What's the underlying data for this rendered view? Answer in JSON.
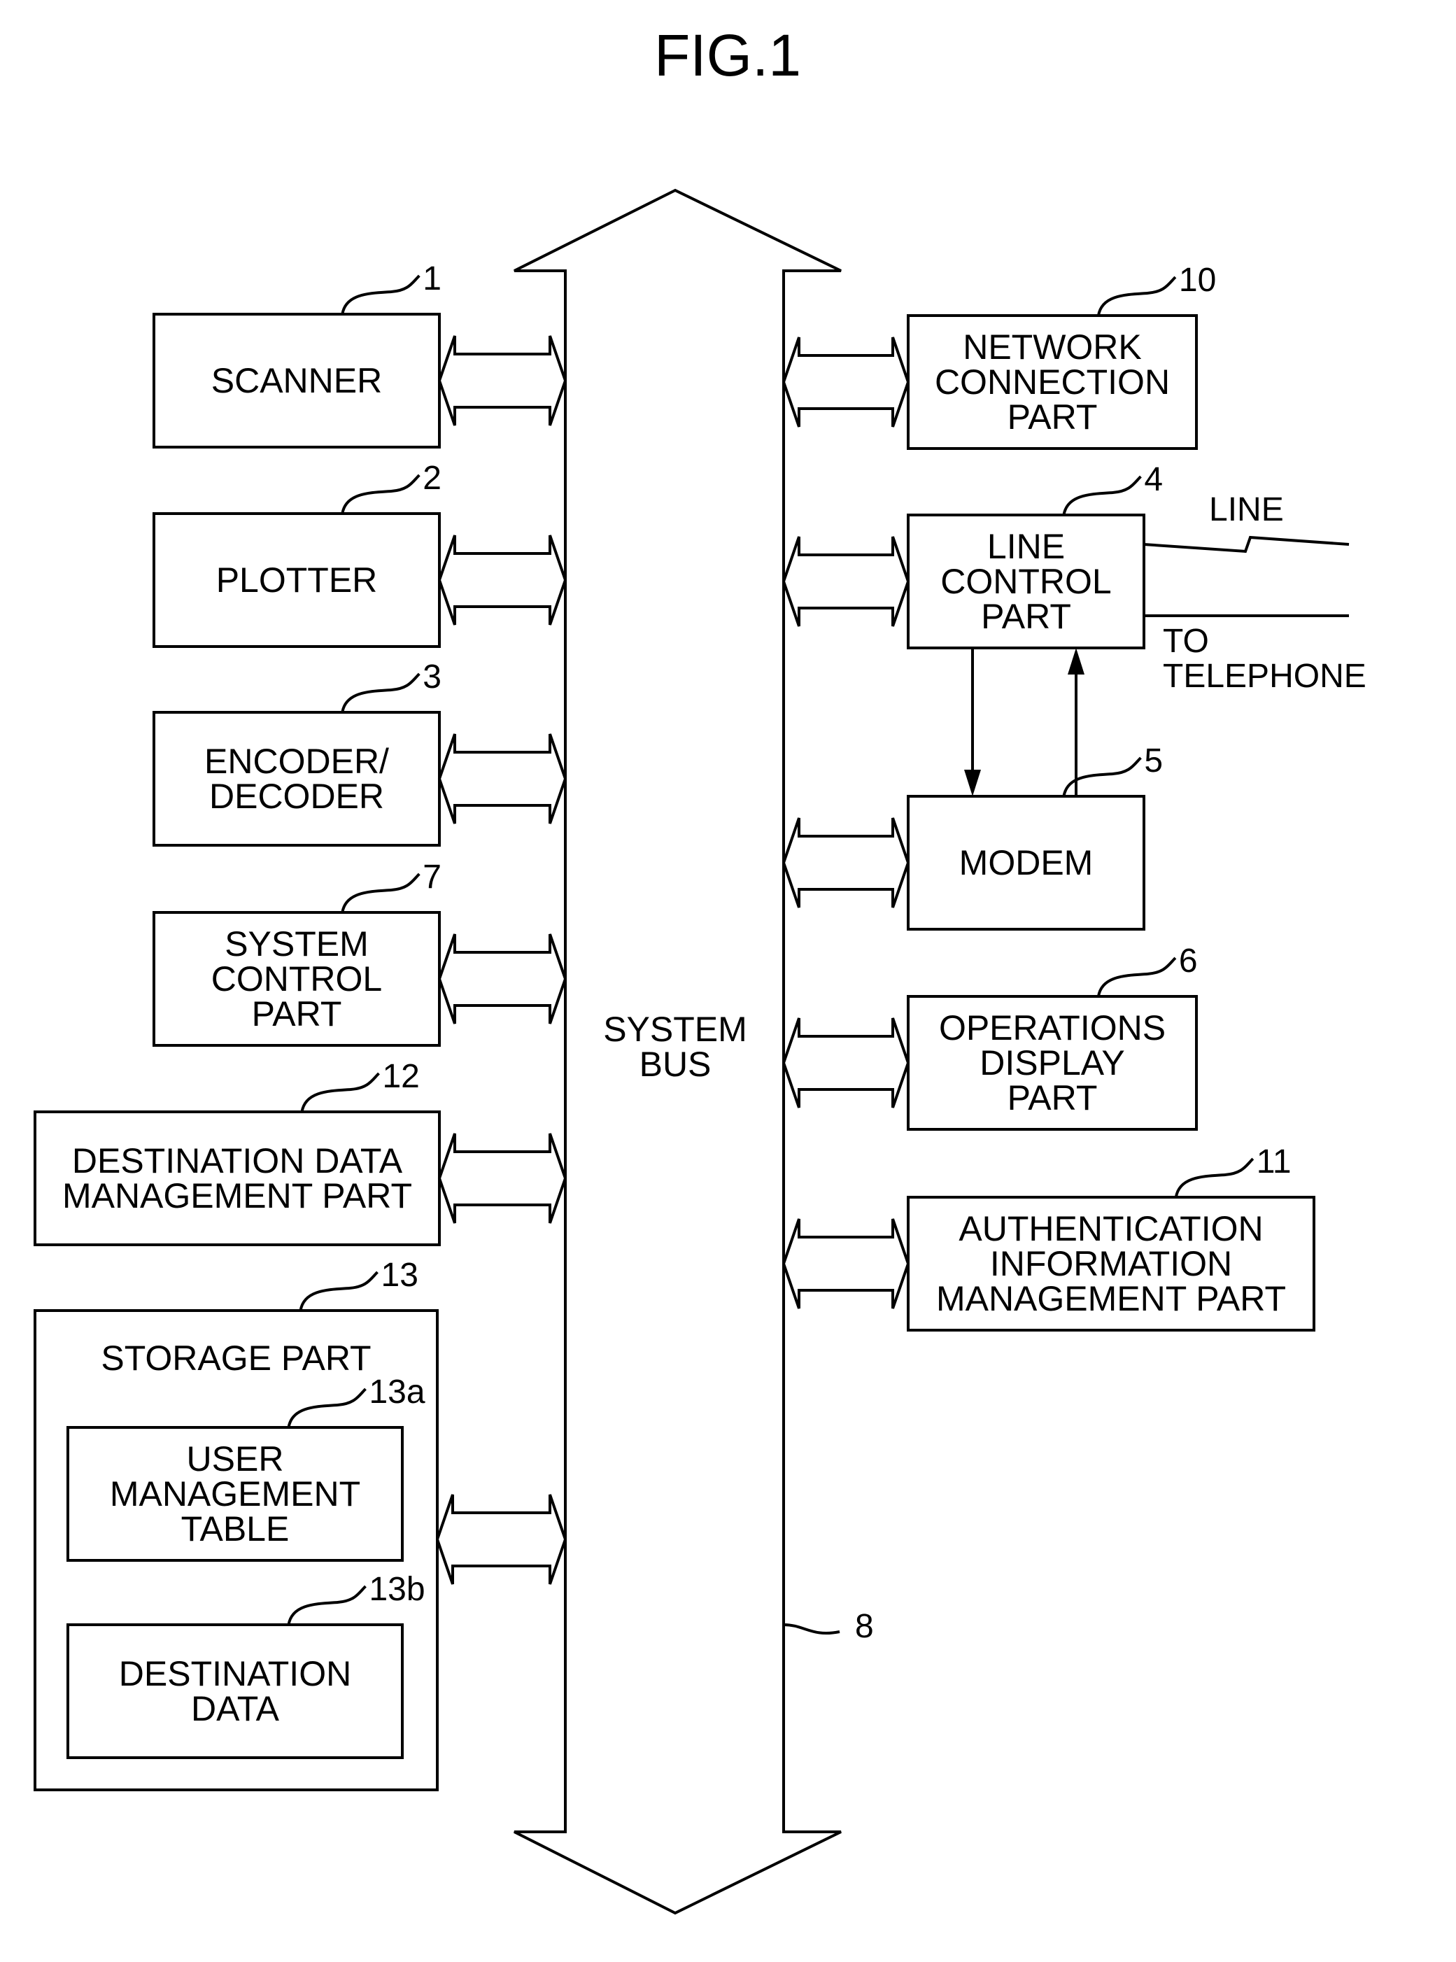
{
  "figure": {
    "title": "FIG.1"
  },
  "system_bus": {
    "label_lines": [
      "SYSTEM",
      "BUS"
    ],
    "ref": "8"
  },
  "blocks": {
    "scanner": {
      "ref": "1",
      "lines": [
        "SCANNER"
      ]
    },
    "plotter": {
      "ref": "2",
      "lines": [
        "PLOTTER"
      ]
    },
    "encoder": {
      "ref": "3",
      "lines": [
        "ENCODER/",
        "DECODER"
      ]
    },
    "system_control": {
      "ref": "7",
      "lines": [
        "SYSTEM",
        "CONTROL",
        "PART"
      ]
    },
    "destination_mgmt": {
      "ref": "12",
      "lines": [
        "DESTINATION DATA",
        "MANAGEMENT PART"
      ]
    },
    "storage": {
      "ref": "13",
      "lines": [
        "STORAGE PART"
      ]
    },
    "user_table": {
      "ref": "13a",
      "lines": [
        "USER",
        "MANAGEMENT",
        "TABLE"
      ]
    },
    "destination_data": {
      "ref": "13b",
      "lines": [
        "DESTINATION",
        "DATA"
      ]
    },
    "network": {
      "ref": "10",
      "lines": [
        "NETWORK",
        "CONNECTION",
        "PART"
      ]
    },
    "line_control": {
      "ref": "4",
      "lines": [
        "LINE",
        "CONTROL",
        "PART"
      ]
    },
    "modem": {
      "ref": "5",
      "lines": [
        "MODEM"
      ]
    },
    "operations": {
      "ref": "6",
      "lines": [
        "OPERATIONS",
        "DISPLAY",
        "PART"
      ]
    },
    "authentication": {
      "ref": "11",
      "lines": [
        "AUTHENTICATION",
        "INFORMATION",
        "MANAGEMENT PART"
      ]
    }
  },
  "external": {
    "line_label": "LINE",
    "telephone_lines": [
      "TO",
      "TELEPHONE"
    ]
  }
}
